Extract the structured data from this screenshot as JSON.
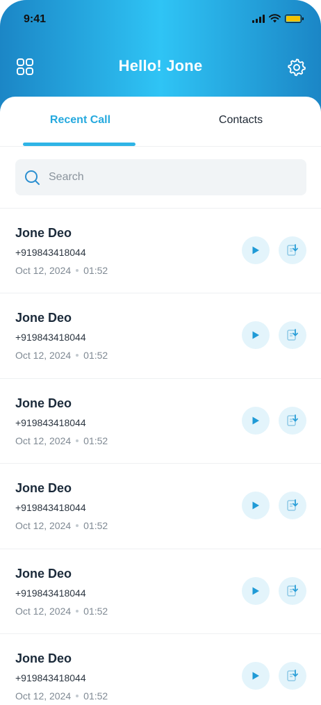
{
  "status_bar": {
    "time": "9:41"
  },
  "header": {
    "title": "Hello! Jone"
  },
  "tabs": [
    {
      "label": "Recent Call",
      "active": true
    },
    {
      "label": "Contacts",
      "active": false
    }
  ],
  "search": {
    "placeholder": "Search",
    "value": ""
  },
  "calls": [
    {
      "name": "Jone Deo",
      "phone": "+919843418044",
      "date": "Oct 12, 2024",
      "duration": "01:52"
    },
    {
      "name": "Jone Deo",
      "phone": "+919843418044",
      "date": "Oct 12, 2024",
      "duration": "01:52"
    },
    {
      "name": "Jone Deo",
      "phone": "+919843418044",
      "date": "Oct 12, 2024",
      "duration": "01:52"
    },
    {
      "name": "Jone Deo",
      "phone": "+919843418044",
      "date": "Oct 12, 2024",
      "duration": "01:52"
    },
    {
      "name": "Jone Deo",
      "phone": "+919843418044",
      "date": "Oct 12, 2024",
      "duration": "01:52"
    },
    {
      "name": "Jone Deo",
      "phone": "+919843418044",
      "date": "Oct 12, 2024",
      "duration": "01:52"
    }
  ],
  "icons": {
    "menu": "grid-icon",
    "settings": "gear-icon",
    "search": "search-icon",
    "play": "play-icon",
    "download": "download-file-icon"
  },
  "colors": {
    "header_gradient_start": "#1b86c6",
    "header_gradient_mid": "#2fc4f5",
    "accent": "#25a9de",
    "icon_bg": "#e3f4fb",
    "text_primary": "#1b2a3a",
    "text_muted": "#7f8993"
  }
}
